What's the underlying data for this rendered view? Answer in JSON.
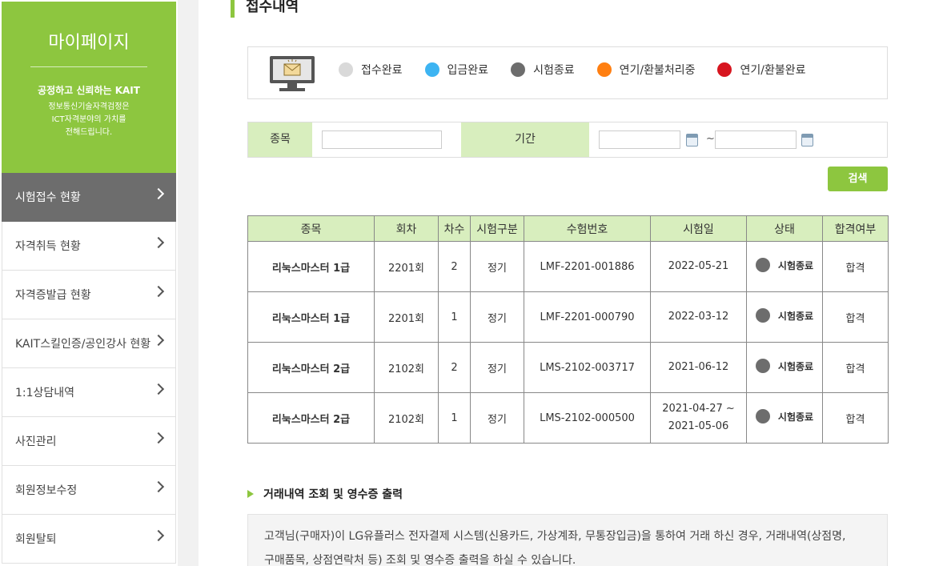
{
  "sidebar": {
    "title": "마이페이지",
    "slogan": "공정하고 신뢰하는 KAIT",
    "desc_line1": "정보통신기술자격검정은",
    "desc_line2": "ICT자격분야의 가치를",
    "desc_line3": "전해드립니다.",
    "items": [
      {
        "label": "시험접수 현황",
        "active": true
      },
      {
        "label": "자격취득 현황"
      },
      {
        "label": "자격증발급 현황"
      },
      {
        "label": "KAIT스킬인증/공인강사 현황"
      },
      {
        "label": "1:1상담내역"
      },
      {
        "label": "사진관리"
      },
      {
        "label": "회원정보수정"
      },
      {
        "label": "회원탈퇴"
      }
    ]
  },
  "main": {
    "title": "접수내역",
    "legend": [
      {
        "label": "접수완료",
        "color": "#d9d9d9"
      },
      {
        "label": "입금완료",
        "color": "#3db4f2"
      },
      {
        "label": "시험종료",
        "color": "#6d6d6d"
      },
      {
        "label": "연기/환불처리중",
        "color": "#ff7f11"
      },
      {
        "label": "연기/환불완료",
        "color": "#d7151f"
      }
    ],
    "search": {
      "subject_label": "종목",
      "subject_value": "",
      "period_label": "기간",
      "start_value": "",
      "end_value": "",
      "tilde": "~",
      "button_label": "검색"
    },
    "table": {
      "headers": [
        "종목",
        "회차",
        "차수",
        "시험구분",
        "수험번호",
        "시험일",
        "상태",
        "합격여부"
      ],
      "rows": [
        {
          "subject": "리눅스마스터 1급",
          "round": "2201회",
          "stage": "2",
          "type": "정기",
          "exam_no": "LMF-2201-001886",
          "date1": "2022-05-21",
          "date2": "",
          "status": "시험종료",
          "result": "합격"
        },
        {
          "subject": "리눅스마스터 1급",
          "round": "2201회",
          "stage": "1",
          "type": "정기",
          "exam_no": "LMF-2201-000790",
          "date1": "2022-03-12",
          "date2": "",
          "status": "시험종료",
          "result": "합격"
        },
        {
          "subject": "리눅스마스터 2급",
          "round": "2102회",
          "stage": "2",
          "type": "정기",
          "exam_no": "LMS-2102-003717",
          "date1": "2021-06-12",
          "date2": "",
          "status": "시험종료",
          "result": "합격"
        },
        {
          "subject": "리눅스마스터 2급",
          "round": "2102회",
          "stage": "1",
          "type": "정기",
          "exam_no": "LMS-2102-000500",
          "date1": "2021-04-27 ~",
          "date2": "2021-05-06",
          "status": "시험종료",
          "result": "합격"
        }
      ]
    },
    "transaction": {
      "heading": "거래내역 조회 및 영수증 출력",
      "notice_line1": "고객님(구매자)이 LG유플러스 전자결제 시스템(신용카드, 가상계좌, 무통장입금)을 통하여 거래 하신 경우, 거래내역(상점명,",
      "notice_line2": "구매품목, 상점연락처 등) 조회 및 영수증 출력을 하실 수 있습니다."
    }
  }
}
